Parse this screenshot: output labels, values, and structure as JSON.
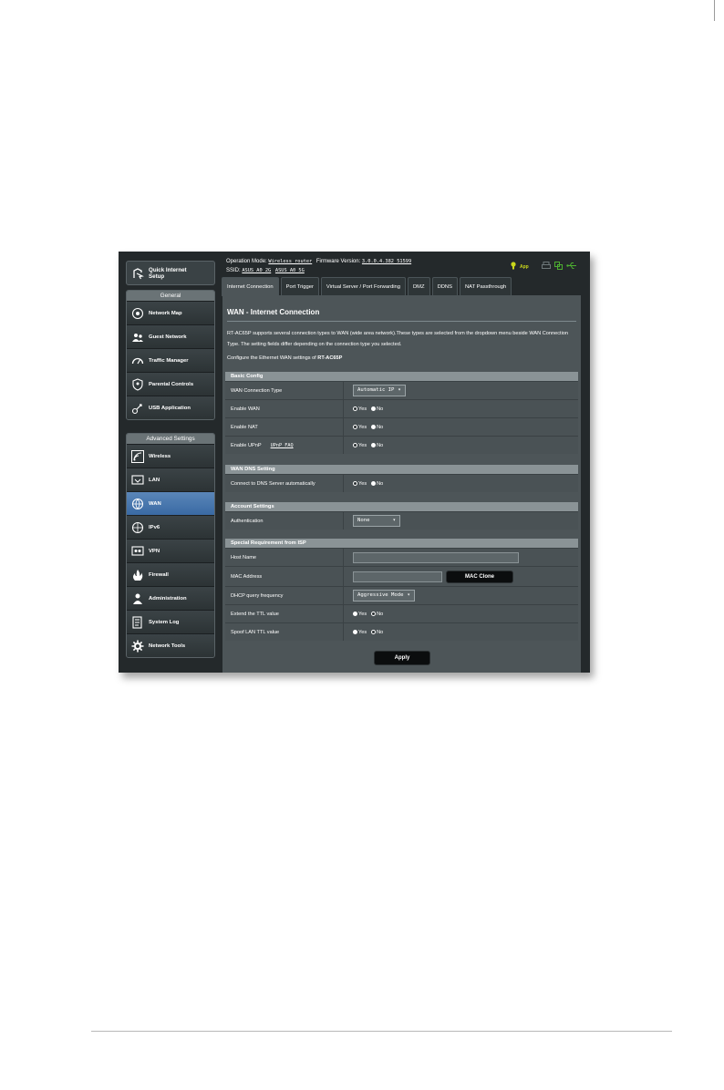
{
  "topbar": {
    "operation_mode_label": "Operation Mode:",
    "operation_mode_value": "Wireless router",
    "firmware_label": "Firmware Version:",
    "firmware_value": "3.0.0.4.382_51599",
    "ssid_label": "SSID:",
    "ssid_2g": "ASUS_A0_2G",
    "ssid_5g": "ASUS_A0_5G",
    "app_label": "App"
  },
  "sidebar": {
    "quick_setup": "Quick Internet Setup",
    "general_header": "General",
    "general_items": [
      {
        "label": "Network Map",
        "icon": "network-map-icon"
      },
      {
        "label": "Guest Network",
        "icon": "guest-network-icon"
      },
      {
        "label": "Traffic Manager",
        "icon": "traffic-manager-icon"
      },
      {
        "label": "Parental Controls",
        "icon": "parental-controls-icon"
      },
      {
        "label": "USB Application",
        "icon": "usb-application-icon"
      }
    ],
    "advanced_header": "Advanced Settings",
    "advanced_items": [
      {
        "label": "Wireless",
        "icon": "wireless-icon"
      },
      {
        "label": "LAN",
        "icon": "lan-icon"
      },
      {
        "label": "WAN",
        "icon": "wan-icon",
        "active": true
      },
      {
        "label": "IPv6",
        "icon": "ipv6-icon"
      },
      {
        "label": "VPN",
        "icon": "vpn-icon"
      },
      {
        "label": "Firewall",
        "icon": "firewall-icon"
      },
      {
        "label": "Administration",
        "icon": "administration-icon"
      },
      {
        "label": "System Log",
        "icon": "system-log-icon"
      },
      {
        "label": "Network Tools",
        "icon": "network-tools-icon"
      }
    ]
  },
  "tabs": [
    "Internet Connection",
    "Port Trigger",
    "Virtual Server / Port Forwarding",
    "DMZ",
    "DDNS",
    "NAT Passthrough"
  ],
  "content": {
    "title": "WAN - Internet Connection",
    "description": "RT-AC65P supports several connection types to WAN (wide area network).These types are selected from the dropdown menu beside WAN Connection Type. The setting fields differ depending on the connection type you selected.",
    "configure_prefix": "Configure the Ethernet WAN settings of",
    "model": "RT-AC65P"
  },
  "basic_config": {
    "header": "Basic Config",
    "wan_connection_type_label": "WAN Connection Type",
    "wan_connection_type_value": "Automatic IP",
    "enable_wan_label": "Enable WAN",
    "enable_nat_label": "Enable NAT",
    "enable_upnp_label": "Enable UPnP",
    "upnp_faq_link": "UPnP FAQ"
  },
  "wan_dns": {
    "header": "WAN DNS Setting",
    "connect_dns_label": "Connect to DNS Server automatically"
  },
  "account": {
    "header": "Account Settings",
    "authentication_label": "Authentication",
    "authentication_value": "None"
  },
  "isp": {
    "header": "Special Requirement from ISP",
    "host_name_label": "Host Name",
    "mac_address_label": "MAC Address",
    "mac_clone_button": "MAC Clone",
    "dhcp_freq_label": "DHCP query frequency",
    "dhcp_freq_value": "Aggressive Mode",
    "extend_ttl_label": "Extend the TTL value",
    "spoof_ttl_label": "Spoof LAN TTL value"
  },
  "radio": {
    "yes": "Yes",
    "no": "No"
  },
  "apply_button": "Apply"
}
